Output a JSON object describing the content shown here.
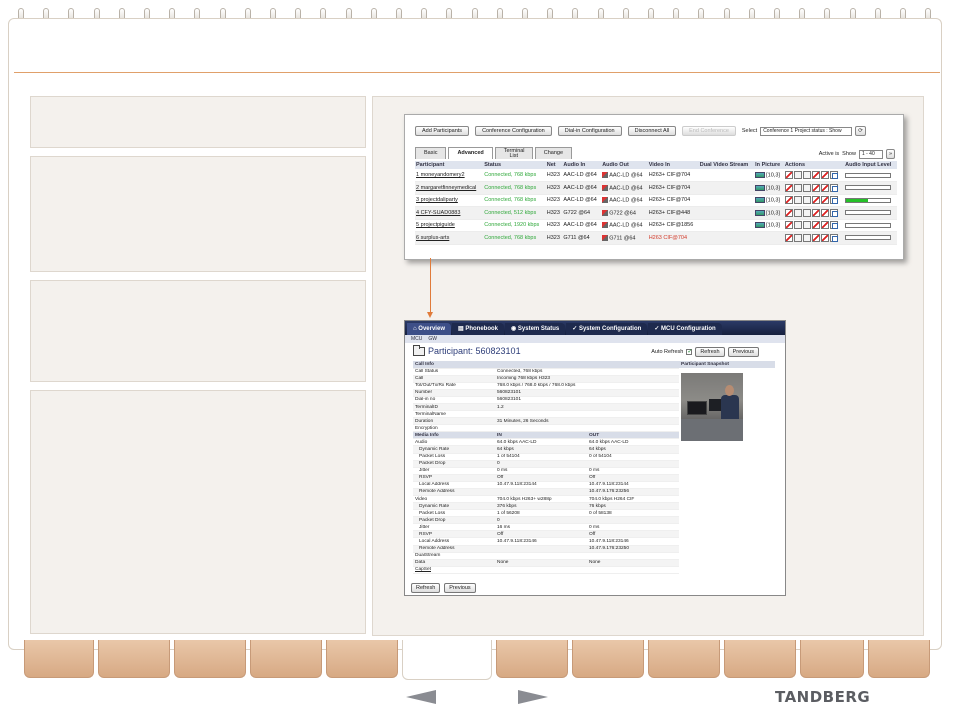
{
  "colors": {
    "accent": "#e07b3a",
    "tab_fill": "#dfb491",
    "panel_bg": "#f4f1ed",
    "ok_green": "#2fa83a",
    "nav_blue": "#1e2a4e"
  },
  "conference": {
    "buttons": {
      "add_participants": "Add Participants",
      "conference_configuration": "Conference Configuration",
      "dial_in_configuration": "Dial-in Configuration",
      "disconnect_all": "Disconnect All",
      "end_conference": "End Conference"
    },
    "select_label": "Select",
    "select_value": "Conference 1 Project status : Show",
    "tabs": [
      "Basic",
      "Advanced",
      "Terminal List",
      "Change"
    ],
    "active_label": "Active is",
    "show_label": "Show",
    "show_value": "1 - 40",
    "columns": [
      "Participant",
      "Status",
      "Net",
      "Audio In",
      "Audio Out",
      "Video In",
      "Dual Video Stream",
      "In Picture",
      "Actions",
      "Audio Input Level"
    ],
    "rows": [
      {
        "name": "1 moneyandomery2",
        "status": "Connected, 768 kbps",
        "net": "H323",
        "audio_in": "AAC-LD @64",
        "audio_out": "AAC-LD @64",
        "video_in": "H263+ CIF@704",
        "in_picture": "[10,3]",
        "level": 0
      },
      {
        "name": "2 margaretfinneymedical",
        "status": "Connected, 768 kbps",
        "net": "H323",
        "audio_in": "AAC-LD @64",
        "audio_out": "AAC-LD @64",
        "video_in": "H263+ CIF@704",
        "in_picture": "[10,3]",
        "level": 0
      },
      {
        "name": "3 projectdaliparty",
        "status": "Connected, 768 kbps",
        "net": "H323",
        "audio_in": "AAC-LD @64",
        "audio_out": "AAC-LD @64",
        "video_in": "H263+ CIF@704",
        "in_picture": "[10,3]",
        "level": 0.5
      },
      {
        "name": "4 CFY-SUAD0883",
        "status": "Connected, 512 kbps",
        "net": "H323",
        "audio_in": "G722 @64",
        "audio_out": "G722 @64",
        "video_in": "H263+ CIF@448",
        "in_picture": "[10,3]",
        "level": 0
      },
      {
        "name": "5 projectpiguide",
        "status": "Connected, 1920 kbps",
        "net": "H323",
        "audio_in": "AAC-LD @64",
        "audio_out": "AAC-LD @64",
        "video_in": "H263+ CIF@1856",
        "in_picture": "[10,3]",
        "level": 0
      },
      {
        "name": "6 surplus-arts",
        "status": "Connected, 768 kbps",
        "net": "H323",
        "audio_in": "G711 @64",
        "audio_out": "G711 @64",
        "video_in": "H263 CIF@704",
        "in_picture": "",
        "level": 0
      }
    ]
  },
  "participant": {
    "nav_tabs": [
      "Overview",
      "Phonebook",
      "System Status",
      "System Configuration",
      "MCU Configuration"
    ],
    "sub_nav": [
      "MCU",
      "GW"
    ],
    "title": "Participant: 560823101",
    "auto_refresh": "Auto Refresh",
    "refresh": "Refresh",
    "previous": "Previous",
    "snapshot_label": "Participant Snapshot",
    "rows": [
      {
        "label": "Call Info",
        "in": "",
        "out": "",
        "type": "hdr"
      },
      {
        "label": "Call Status",
        "in": "Connected, 768 kbps",
        "out": ""
      },
      {
        "label": "Call",
        "in": "Incoming 768 kbps H323",
        "out": ""
      },
      {
        "label": "Tot/Out/Tx/Rx Rate",
        "in": "768.0 kbps / 768.0 kbps / 768.0 kbps",
        "out": ""
      },
      {
        "label": "Number",
        "in": "560823101",
        "out": ""
      },
      {
        "label": "Dial-in no",
        "in": "560823101",
        "out": ""
      },
      {
        "label": "TerminalID",
        "in": "1.2",
        "out": ""
      },
      {
        "label": "TerminalName",
        "in": "",
        "out": ""
      },
      {
        "label": "Duration",
        "in": "31 Minutes, 26 Seconds",
        "out": ""
      },
      {
        "label": "Encryption",
        "in": "",
        "out": ""
      },
      {
        "label": "Media Info",
        "in": "IN",
        "out": "OUT",
        "type": "hdr"
      },
      {
        "label": "Audio",
        "in": "64.0 kbps AAC-LD",
        "out": "64.0 kbps AAC-LD"
      },
      {
        "label": "Dynamic Rate",
        "in": "64 kbps",
        "out": "64 kbps",
        "indent": true
      },
      {
        "label": "Packet Loss",
        "in": "1 of 54104",
        "out": "0 of 54104",
        "indent": true
      },
      {
        "label": "Packet Drop",
        "in": "0",
        "out": "",
        "indent": true
      },
      {
        "label": "Jitter",
        "in": "0 ms",
        "out": "0 ms",
        "indent": true
      },
      {
        "label": "RSVP",
        "in": "Off",
        "out": "Off",
        "indent": true
      },
      {
        "label": "Local Address",
        "in": "10.47.9.118:23144",
        "out": "10.47.9.118:23144",
        "indent": true
      },
      {
        "label": "Remote Address",
        "in": "",
        "out": "10.47.9.176:23256",
        "indent": true
      },
      {
        "label": "Video",
        "in": "704.0 kbps H263+ w288p",
        "out": "704.0 kbps H264 CIF",
        "indent": false
      },
      {
        "label": "Dynamic Rate",
        "in": "376 kbps",
        "out": "76 kbps",
        "indent": true
      },
      {
        "label": "Packet Loss",
        "in": "1 of 56208",
        "out": "0 of 58138",
        "indent": true
      },
      {
        "label": "Packet Drop",
        "in": "0",
        "out": "",
        "indent": true
      },
      {
        "label": "Jitter",
        "in": "16 ms",
        "out": "0 ms",
        "indent": true
      },
      {
        "label": "RSVP",
        "in": "Off",
        "out": "Off",
        "indent": true
      },
      {
        "label": "Local Address",
        "in": "10.47.9.118:23146",
        "out": "10.47.9.118:23146",
        "indent": true
      },
      {
        "label": "Remote Address",
        "in": "",
        "out": "10.47.9.176:23250",
        "indent": true
      },
      {
        "label": "DualStream",
        "in": "",
        "out": ""
      },
      {
        "label": "Data",
        "in": "None",
        "out": "None"
      },
      {
        "label": "CapSet",
        "in": "",
        "out": "",
        "link": true
      }
    ]
  },
  "footer": {
    "logo": "TANDBERG"
  }
}
